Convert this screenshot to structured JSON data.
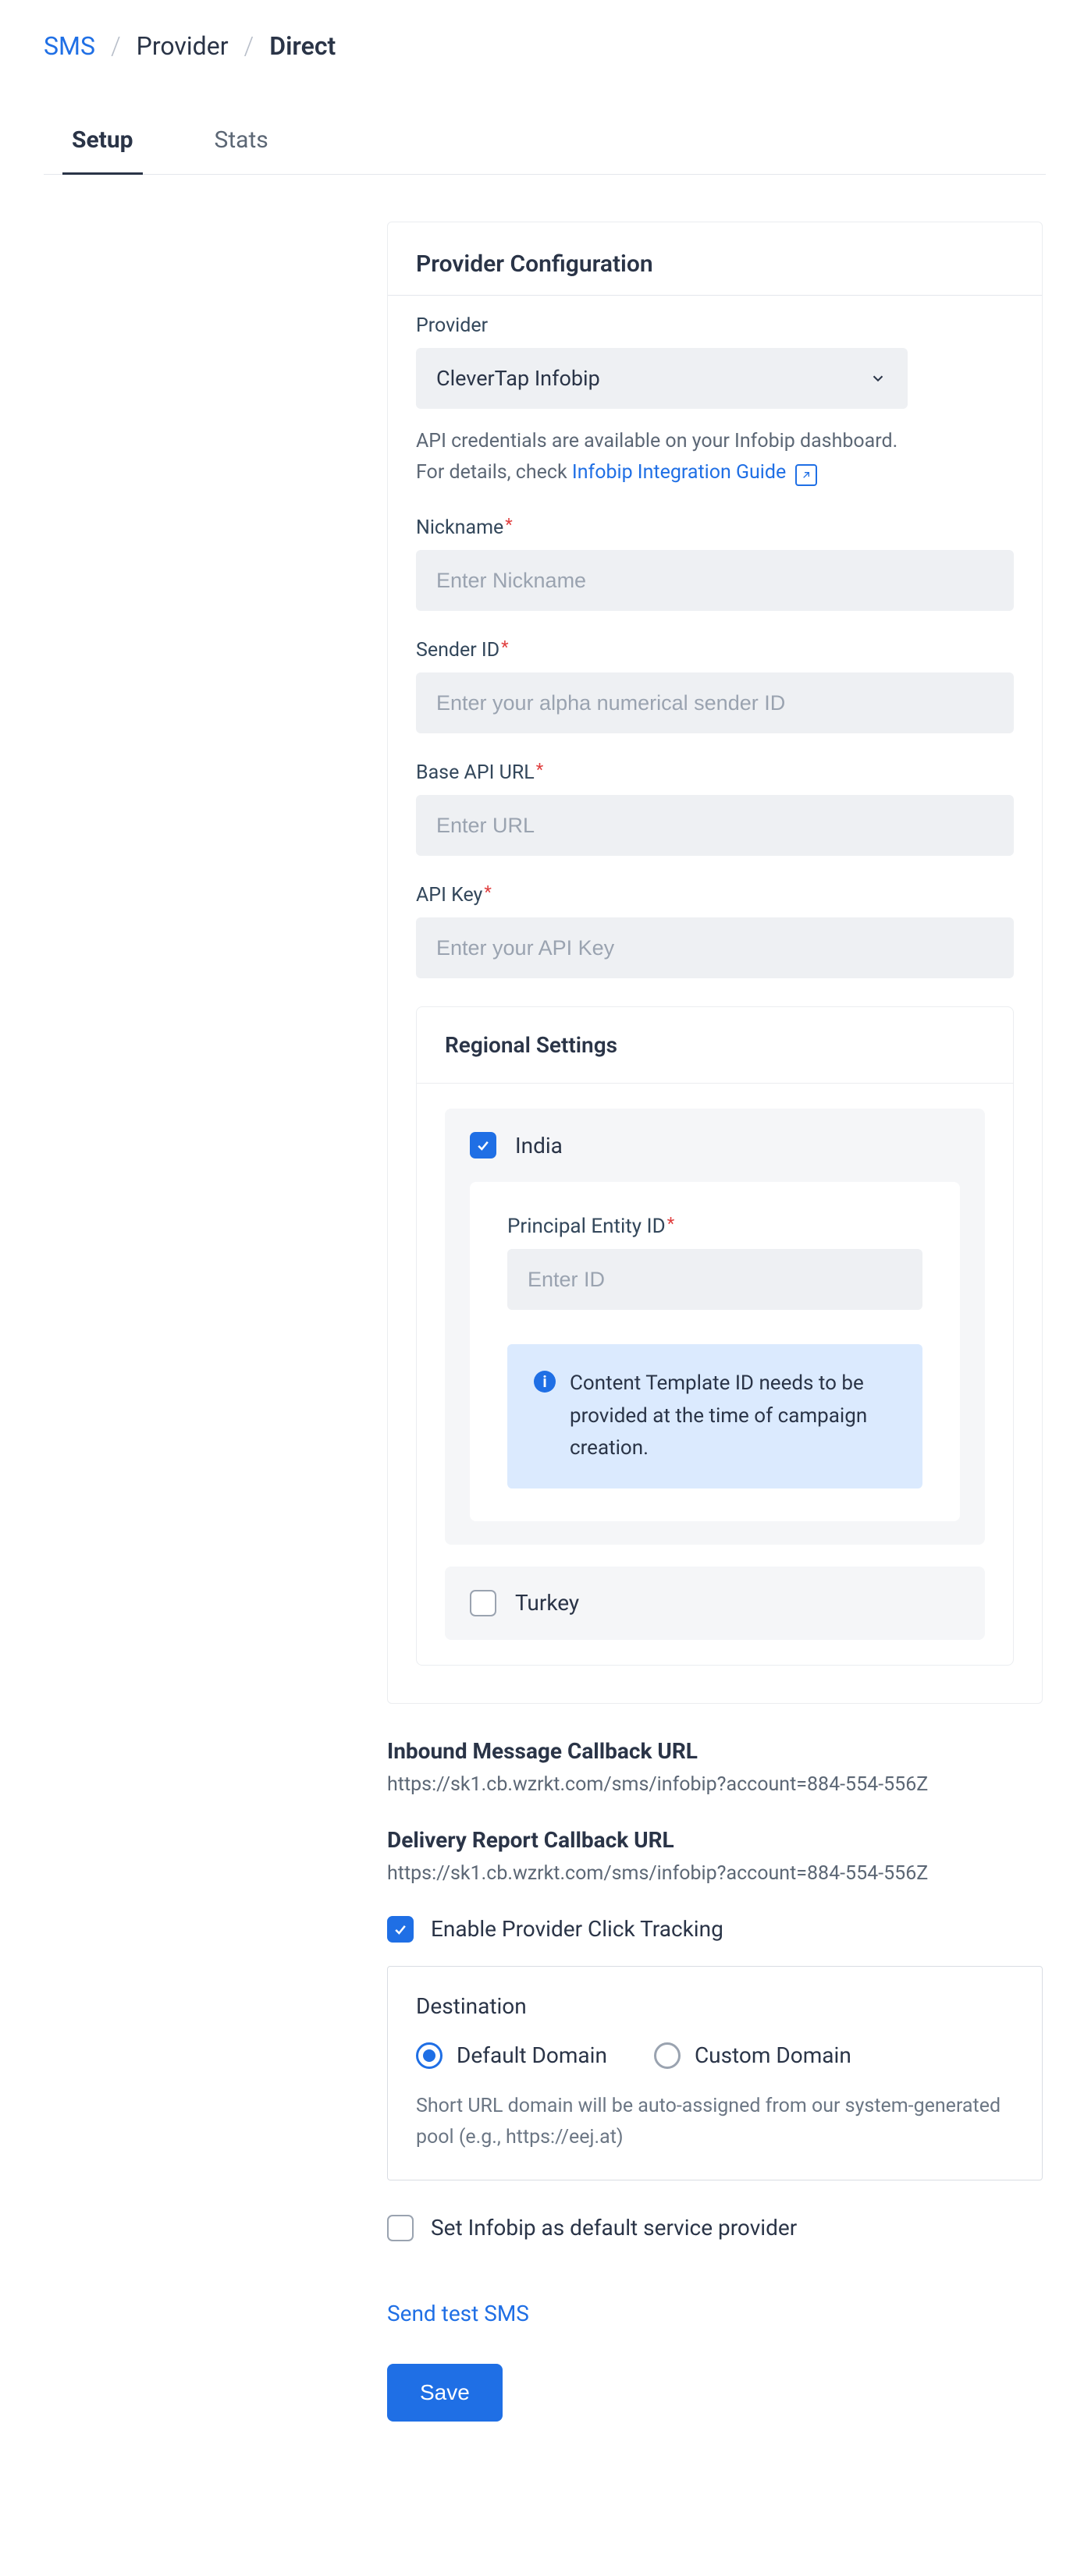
{
  "breadcrumb": {
    "root": "SMS",
    "mid": "Provider",
    "current": "Direct"
  },
  "tabs": {
    "setup": "Setup",
    "stats": "Stats"
  },
  "config": {
    "heading": "Provider Configuration",
    "provider_label": "Provider",
    "provider_value": "CleverTap Infobip",
    "helper_line1": "API credentials are available on your Infobip dashboard.",
    "helper_line2_prefix": "For details, check ",
    "helper_link": "Infobip Integration Guide",
    "nickname_label": "Nickname",
    "nickname_placeholder": "Enter Nickname",
    "sender_label": "Sender ID",
    "sender_placeholder": "Enter your alpha numerical sender ID",
    "baseurl_label": "Base API URL",
    "baseurl_placeholder": "Enter URL",
    "apikey_label": "API Key",
    "apikey_placeholder": "Enter your API Key"
  },
  "regional": {
    "heading": "Regional Settings",
    "india": {
      "name": "India",
      "entity_label": "Principal Entity ID",
      "entity_placeholder": "Enter ID",
      "info_text": "Content Template ID needs to be provided at the time of campaign creation."
    },
    "turkey": {
      "name": "Turkey"
    }
  },
  "callbacks": {
    "inbound_title": "Inbound Message Callback URL",
    "inbound_url": "https://sk1.cb.wzrkt.com/sms/infobip?account=884-554-556Z",
    "delivery_title": "Delivery Report Callback URL",
    "delivery_url": "https://sk1.cb.wzrkt.com/sms/infobip?account=884-554-556Z"
  },
  "tracking": {
    "enable_label": "Enable Provider Click Tracking"
  },
  "destination": {
    "title": "Destination",
    "default_label": "Default Domain",
    "custom_label": "Custom Domain",
    "help": "Short URL domain will be auto-assigned from our system-generated pool (e.g., https://eej.at)"
  },
  "default_provider_label": "Set Infobip as default service provider",
  "send_test": "Send test SMS",
  "save": "Save"
}
